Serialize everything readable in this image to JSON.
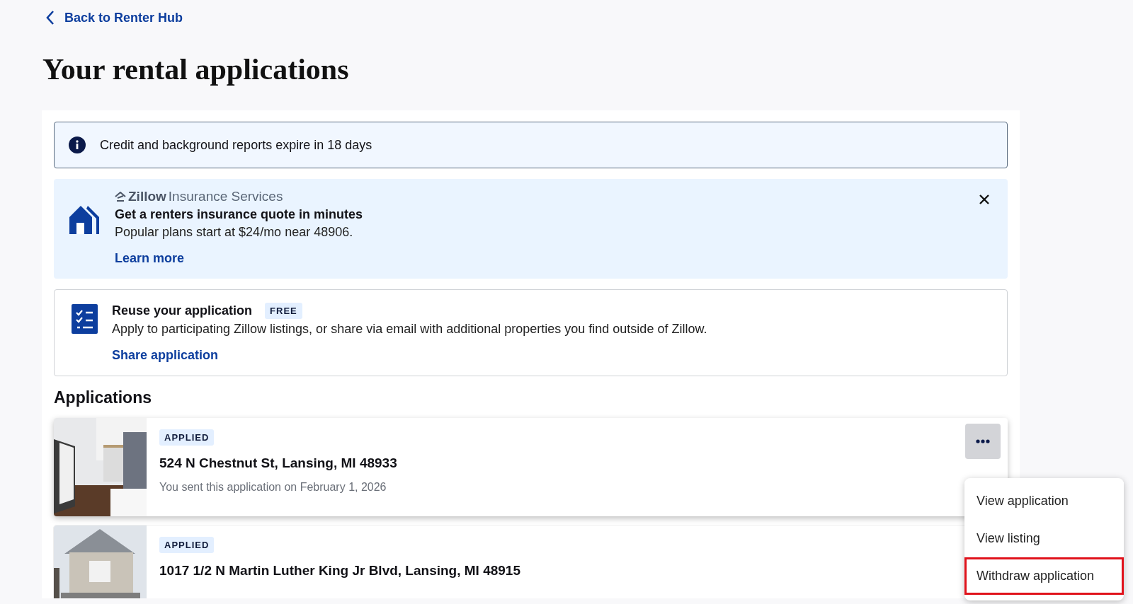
{
  "back_link": "Back to Renter Hub",
  "title": "Your rental applications",
  "notice": {
    "text": "Credit and background reports expire in 18 days"
  },
  "insurance_banner": {
    "brand": "Zillow",
    "brand_suffix": "Insurance Services",
    "heading": "Get a renters insurance quote in minutes",
    "body": "Popular plans start at $24/mo near 48906.",
    "link": "Learn more"
  },
  "reuse_card": {
    "heading": "Reuse your application",
    "badge": "FREE",
    "body": "Apply to participating Zillow listings, or share via email with additional properties you find outside of Zillow.",
    "link": "Share application"
  },
  "applications": {
    "heading": "Applications",
    "items": [
      {
        "status": "APPLIED",
        "address": "524 N Chestnut St, Lansing, MI 48933",
        "sent": "You sent this application on February 1, 2026",
        "menu_open": true
      },
      {
        "status": "APPLIED",
        "address": "1017 1/2 N Martin Luther King Jr Blvd, Lansing, MI 48915",
        "menu_open": false
      }
    ]
  },
  "menu": {
    "items": [
      {
        "label": "View application",
        "highlighted": false
      },
      {
        "label": "View listing",
        "highlighted": false
      },
      {
        "label": "Withdraw application",
        "highlighted": true
      }
    ]
  }
}
